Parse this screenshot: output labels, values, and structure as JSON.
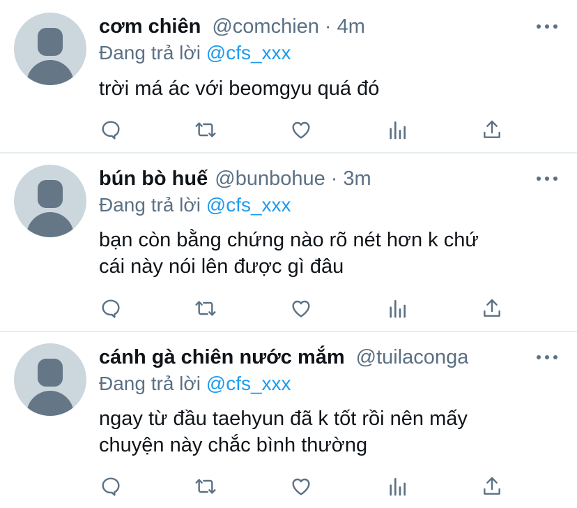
{
  "tweets": [
    {
      "name": "cơm chiên",
      "handle": "@comchien",
      "time": "· 4m",
      "replying_prefix": "Đang trả lời ",
      "replying_to": "@cfs_xxx",
      "text_lines": [
        "trời má ác với beomgyu quá đó"
      ]
    },
    {
      "name": "bún bò huế",
      "handle": "@bunbohue",
      "time": "· 3m",
      "replying_prefix": "Đang trả lời ",
      "replying_to": "@cfs_xxx",
      "text_lines": [
        "bạn còn bằng chứng nào rõ nét hơn k chứ",
        "cái này nói lên được gì đâu"
      ]
    },
    {
      "name": "cánh gà chiên nước mắm",
      "handle": "@tuilaconga",
      "time": "",
      "replying_prefix": "Đang trả lời ",
      "replying_to": "@cfs_xxx",
      "text_lines": [
        "ngay từ đầu taehyun đã k tốt rồi nên mấy",
        "chuyện này chắc bình thường"
      ]
    }
  ],
  "icons": {
    "reply": "reply-icon",
    "retweet": "retweet-icon",
    "like": "like-icon",
    "analytics": "analytics-icon",
    "share": "share-icon",
    "more": "more-icon"
  },
  "colors": {
    "text": "#0f1419",
    "secondary": "#5b7083",
    "mention": "#1d9bf0",
    "divider": "#e6ecf0",
    "avatar_bg": "#ccd6dd",
    "avatar_fg": "#657786"
  }
}
